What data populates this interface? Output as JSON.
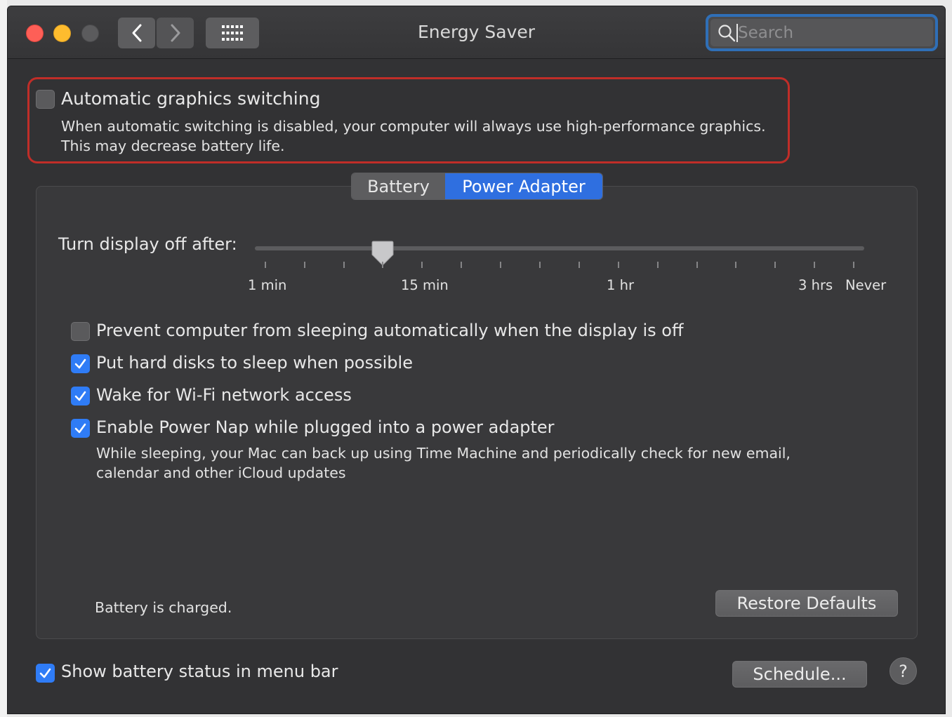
{
  "window": {
    "title": "Energy Saver",
    "search_placeholder": "Search"
  },
  "graphics_switching": {
    "label": "Automatic graphics switching",
    "checked": false,
    "description_line1": "When automatic switching is disabled, your computer will always use high-performance graphics.",
    "description_line2": "This may decrease battery life."
  },
  "tabs": {
    "battery": "Battery",
    "power_adapter": "Power Adapter",
    "selected": "Power Adapter"
  },
  "display_sleep": {
    "label": "Turn display off after:",
    "value": "10 min",
    "tick_labels": [
      "1 min",
      "15 min",
      "1 hr",
      "3 hrs",
      "Never"
    ]
  },
  "options": [
    {
      "label": "Prevent computer from sleeping automatically when the display is off",
      "checked": false
    },
    {
      "label": "Put hard disks to sleep when possible",
      "checked": true
    },
    {
      "label": "Wake for Wi-Fi network access",
      "checked": true
    },
    {
      "label": "Enable Power Nap while plugged into a power adapter",
      "checked": true
    }
  ],
  "power_nap_description": {
    "line1": "While sleeping, your Mac can back up using Time Machine and periodically check for new email,",
    "line2": "calendar and other iCloud updates"
  },
  "status": "Battery is charged.",
  "buttons": {
    "restore_defaults": "Restore Defaults",
    "schedule": "Schedule...",
    "help": "?"
  },
  "menu_bar_option": {
    "label": "Show battery status in menu bar",
    "checked": true
  },
  "colors": {
    "accent": "#2f7cf6",
    "highlight_border": "#c02d28",
    "window_bg": "#323234"
  }
}
